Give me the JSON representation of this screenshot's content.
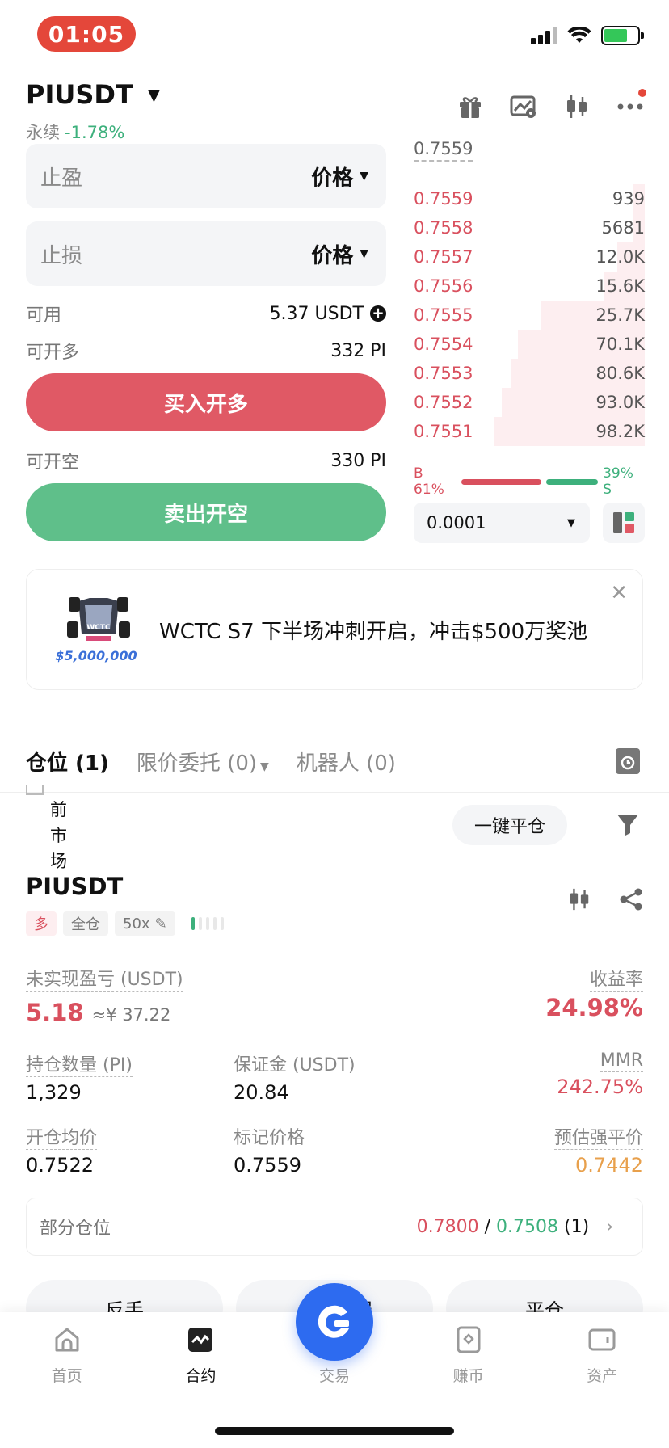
{
  "status": {
    "time": "01:05"
  },
  "header": {
    "pair": "PIUSDT",
    "type": "永续",
    "change": "-1.78%"
  },
  "form": {
    "tp_label": "止盈",
    "tp_type": "价格",
    "sl_label": "止损",
    "sl_type": "价格",
    "avail_label": "可用",
    "avail_value": "5.37 USDT",
    "open_long_label": "可开多",
    "open_long_value": "332 PI",
    "buy_label": "买入开多",
    "open_short_label": "可开空",
    "open_short_value": "330 PI",
    "sell_label": "卖出开空"
  },
  "orderbook": {
    "last_price": "0.7559",
    "asks": [
      {
        "price": "0.7559",
        "qty": "939",
        "depth": 0.05
      },
      {
        "price": "0.7558",
        "qty": "5681",
        "depth": 0.05
      },
      {
        "price": "0.7557",
        "qty": "12.0K",
        "depth": 0.12
      },
      {
        "price": "0.7556",
        "qty": "15.6K",
        "depth": 0.18
      },
      {
        "price": "0.7555",
        "qty": "25.7K",
        "depth": 0.45
      },
      {
        "price": "0.7554",
        "qty": "70.1K",
        "depth": 0.55
      },
      {
        "price": "0.7553",
        "qty": "80.6K",
        "depth": 0.58
      },
      {
        "price": "0.7552",
        "qty": "93.0K",
        "depth": 0.62
      },
      {
        "price": "0.7551",
        "qty": "98.2K",
        "depth": 0.65
      }
    ],
    "buy_ratio": "B 61%",
    "sell_ratio": "39% S",
    "buy_pct": 61,
    "sell_pct": 39,
    "tick": "0.0001"
  },
  "banner": {
    "text": "WCTC S7 下半场冲刺开启，冲击$500万奖池",
    "prize": "$5,000,000",
    "badge": "WCTC"
  },
  "tabs": [
    {
      "label": "仓位 (1)"
    },
    {
      "label": "限价委托 (0)"
    },
    {
      "label": "机器人 (0)"
    }
  ],
  "filter_row": {
    "current_market": [
      "当",
      "前",
      "市",
      "场"
    ],
    "close_all": "一键平仓"
  },
  "position": {
    "symbol": "PIUSDT",
    "side": "多",
    "margin_mode": "全仓",
    "leverage": "50x",
    "upnl_label": "未实现盈亏 (USDT)",
    "upnl": "5.18",
    "upnl_cny": "≈¥ 37.22",
    "roe_label": "收益率",
    "roe": "24.98%",
    "size_label": "持仓数量 (PI)",
    "size": "1,329",
    "margin_label": "保证金 (USDT)",
    "margin": "20.84",
    "mmr_label": "MMR",
    "mmr": "242.75%",
    "entry_label": "开仓均价",
    "entry": "0.7522",
    "mark_label": "标记价格",
    "mark": "0.7559",
    "liq_label": "预估强平价",
    "liq": "0.7442",
    "partial_label": "部分仓位",
    "partial_tp": "0.7800",
    "partial_sep": "/",
    "partial_sl": "0.7508",
    "partial_count": "(1)"
  },
  "actions": [
    "反手",
    "止盈止损",
    "平仓"
  ],
  "nav": [
    {
      "label": "首页",
      "icon": "home-icon"
    },
    {
      "label": "合约",
      "icon": "futures-icon"
    },
    {
      "label": "交易",
      "icon": "trade-icon"
    },
    {
      "label": "赚币",
      "icon": "earn-icon"
    },
    {
      "label": "资产",
      "icon": "wallet-icon"
    }
  ],
  "colors": {
    "red": "#d9505e",
    "green": "#3db07c",
    "buy_btn": "#e05965",
    "sell_btn": "#5fbf8a",
    "accent": "#2d6bf0",
    "warning": "#e8a04c"
  }
}
